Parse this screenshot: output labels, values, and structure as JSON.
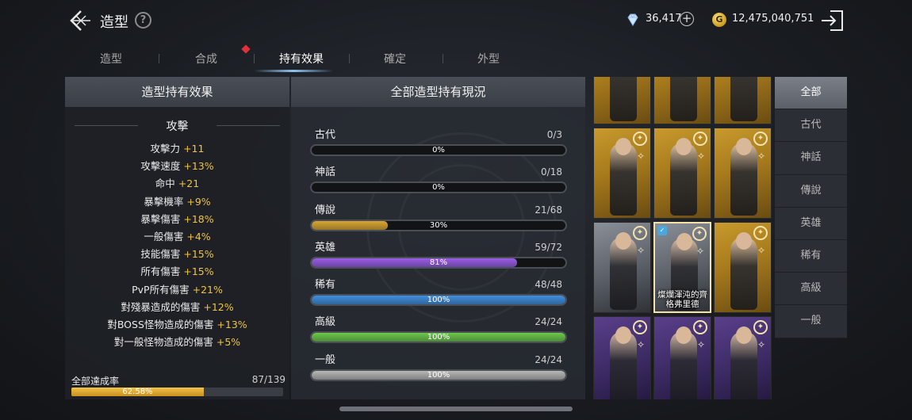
{
  "header": {
    "title": "造型",
    "help_label": "?",
    "currency_gem": "36,417",
    "currency_gold": "12,475,040,751",
    "gold_symbol": "G",
    "plus_label": "+"
  },
  "tabs": [
    {
      "label": "造型",
      "active": false
    },
    {
      "label": "合成",
      "active": false,
      "notification": true
    },
    {
      "label": "持有效果",
      "active": true
    },
    {
      "label": "確定",
      "active": false
    },
    {
      "label": "外型",
      "active": false
    }
  ],
  "left_panel": {
    "title": "造型持有效果",
    "section": "攻擊",
    "stats": [
      {
        "name": "攻擊力",
        "value": "+11"
      },
      {
        "name": "攻擊速度",
        "value": "+13%"
      },
      {
        "name": "命中",
        "value": "+21"
      },
      {
        "name": "暴擊機率",
        "value": "+9%"
      },
      {
        "name": "暴擊傷害",
        "value": "+18%"
      },
      {
        "name": "一般傷害",
        "value": "+4%"
      },
      {
        "name": "技能傷害",
        "value": "+15%"
      },
      {
        "name": "所有傷害",
        "value": "+15%"
      },
      {
        "name": "PvP所有傷害",
        "value": "+21%"
      },
      {
        "name": "對殘暴造成的傷害",
        "value": "+12%"
      },
      {
        "name": "對BOSS怪物造成的傷害",
        "value": "+13%"
      },
      {
        "name": "對一般怪物造成的傷害",
        "value": "+5%"
      }
    ],
    "completion_label": "全部達成率",
    "completion_count": "87/139",
    "completion_percent": "62.58%",
    "completion_fraction": 0.6258
  },
  "mid_panel": {
    "title": "全部造型持有現況",
    "rarities": [
      {
        "name": "古代",
        "count": "0/3",
        "percent": "0%",
        "fraction": 0.0,
        "color": "#6b6b6b"
      },
      {
        "name": "神話",
        "count": "0/18",
        "percent": "0%",
        "fraction": 0.0,
        "color": "#6b6b6b"
      },
      {
        "name": "傳說",
        "count": "21/68",
        "percent": "30%",
        "fraction": 0.3,
        "color": "#d9a632"
      },
      {
        "name": "英雄",
        "count": "59/72",
        "percent": "81%",
        "fraction": 0.81,
        "color": "#9a5ce6"
      },
      {
        "name": "稀有",
        "count": "48/48",
        "percent": "100%",
        "fraction": 1.0,
        "color": "#3f8fe0"
      },
      {
        "name": "高級",
        "count": "24/24",
        "percent": "100%",
        "fraction": 1.0,
        "color": "#6cc84a"
      },
      {
        "name": "一般",
        "count": "24/24",
        "percent": "100%",
        "fraction": 1.0,
        "color": "#b8b8b8"
      }
    ]
  },
  "grid": {
    "cards": [
      {
        "tier": "gold",
        "label": ""
      },
      {
        "tier": "gold",
        "label": ""
      },
      {
        "tier": "gold",
        "label": ""
      },
      {
        "tier": "gold",
        "label": ""
      },
      {
        "tier": "gold",
        "label": ""
      },
      {
        "tier": "gold",
        "label": ""
      },
      {
        "tier": "silver",
        "label": ""
      },
      {
        "tier": "silver",
        "label": "燦爛渾沌的齊格弗里德",
        "selected": true
      },
      {
        "tier": "gold",
        "label": ""
      },
      {
        "tier": "purple",
        "label": ""
      },
      {
        "tier": "purple",
        "label": ""
      },
      {
        "tier": "purple",
        "label": ""
      }
    ]
  },
  "filters": [
    {
      "label": "全部",
      "active": true
    },
    {
      "label": "古代",
      "active": false
    },
    {
      "label": "神話",
      "active": false
    },
    {
      "label": "傳說",
      "active": false
    },
    {
      "label": "英雄",
      "active": false
    },
    {
      "label": "稀有",
      "active": false
    },
    {
      "label": "高級",
      "active": false
    },
    {
      "label": "一般",
      "active": false
    }
  ]
}
